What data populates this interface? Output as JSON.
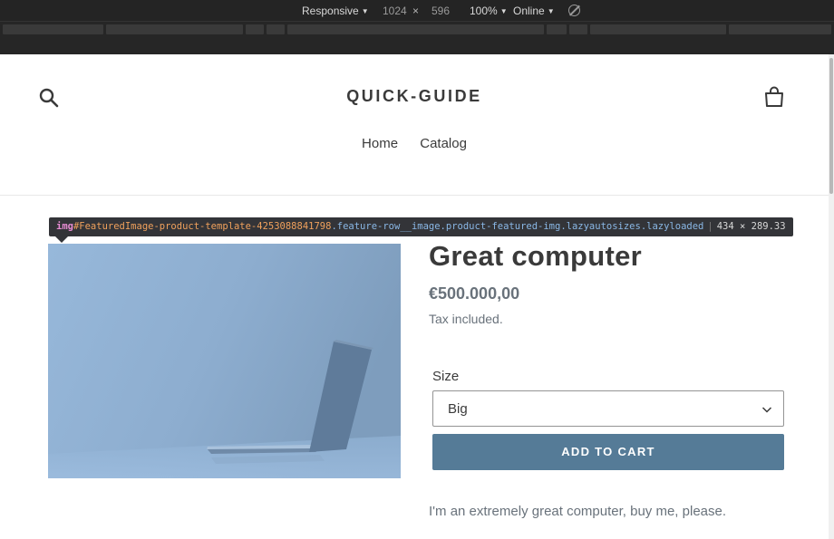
{
  "devtools": {
    "device": "Responsive",
    "width": "1024",
    "height": "596",
    "zoom": "100%",
    "network": "Online"
  },
  "store": {
    "title": "QUICK-GUIDE",
    "nav": [
      "Home",
      "Catalog"
    ]
  },
  "inspector": {
    "tag": "img",
    "id": "#FeaturedImage-product-template-4253088841798",
    "classes": ".feature-row__image.product-featured-img.lazyautosizes.lazyloaded",
    "size": "434 × 289.33"
  },
  "product": {
    "title": "Great computer",
    "price": "€500.000,00",
    "tax_note": "Tax included.",
    "size_label": "Size",
    "size_value": "Big",
    "add_to_cart": "ADD TO CART",
    "description": "I'm an extremely great computer, buy me, please."
  },
  "icons": {
    "search": "search-icon",
    "cart": "cart-icon",
    "select": "chevron-down-icon",
    "rotate": "rotate-icon"
  }
}
